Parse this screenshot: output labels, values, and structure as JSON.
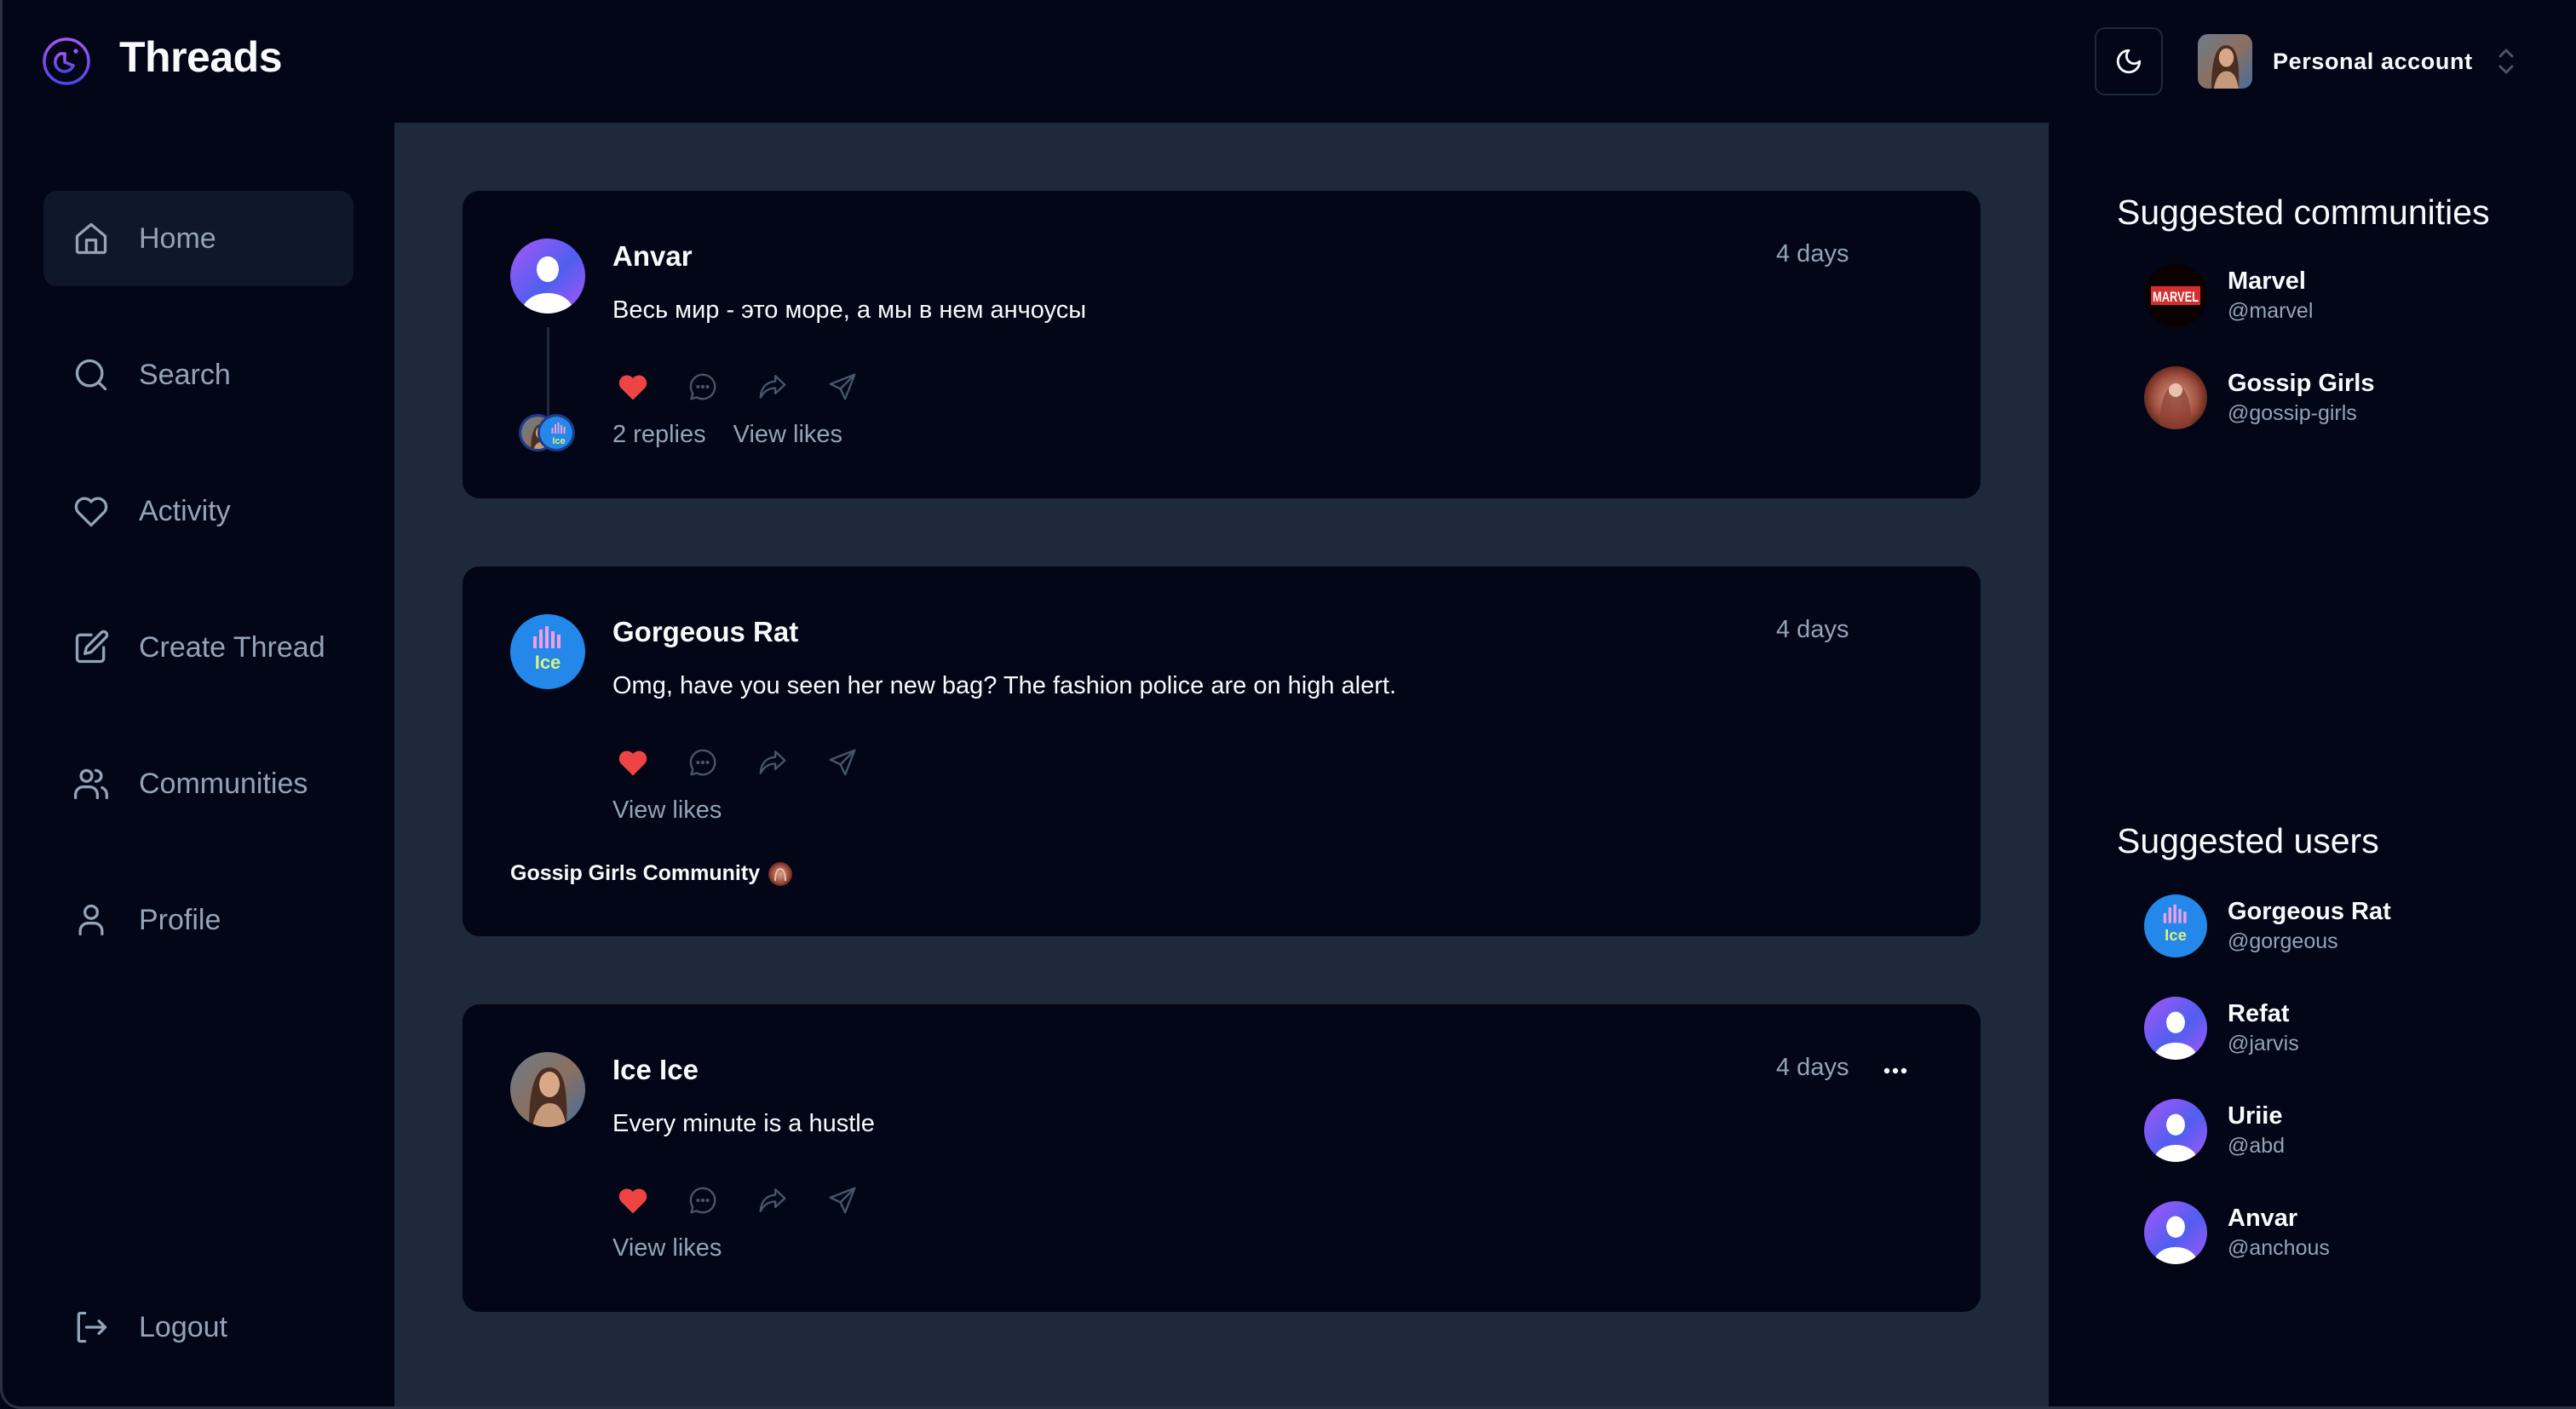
{
  "app": {
    "title": "Threads",
    "logo_icon": "threads-logo-icon",
    "accent_color": "#7c3aed"
  },
  "header": {
    "theme_toggle_icon": "moon-icon",
    "account_label": "Personal account",
    "account_chevron_icon": "chevron-up-down-icon"
  },
  "sidebar": {
    "items": [
      {
        "label": "Home",
        "icon": "home-icon",
        "active": true
      },
      {
        "label": "Search",
        "icon": "search-icon",
        "active": false
      },
      {
        "label": "Activity",
        "icon": "heart-icon",
        "active": false
      },
      {
        "label": "Create Thread",
        "icon": "edit-icon",
        "active": false
      },
      {
        "label": "Communities",
        "icon": "users-icon",
        "active": false
      },
      {
        "label": "Profile",
        "icon": "user-icon",
        "active": false
      }
    ],
    "logout_label": "Logout",
    "logout_icon": "logout-icon"
  },
  "feed": {
    "threads": [
      {
        "author": "Anvar",
        "avatar": "default-avatar",
        "time": "4 days",
        "content": "Весь мир - это море, а мы в нем анчоусы",
        "liked": true,
        "replies_label": "2 replies",
        "view_likes_label": "View likes",
        "show_more": false
      },
      {
        "author": "Gorgeous Rat",
        "avatar": "ice-avatar",
        "time": "4 days",
        "content": "Omg, have you seen her new bag? The fashion police are on high alert.",
        "liked": true,
        "view_likes_label": "View likes",
        "community_label": "Gossip Girls Community",
        "show_more": false
      },
      {
        "author": "Ice Ice",
        "avatar": "photo-avatar",
        "time": "4 days",
        "content": "Every minute is a hustle",
        "liked": true,
        "view_likes_label": "View likes",
        "show_more": true
      }
    ],
    "like_color": "#ef4444"
  },
  "rightbar": {
    "communities_heading": "Suggested communities",
    "communities": [
      {
        "name": "Marvel",
        "handle": "@marvel",
        "avatar": "marvel-logo"
      },
      {
        "name": "Gossip Girls",
        "handle": "@gossip-girls",
        "avatar": "gossip-girls-image"
      }
    ],
    "users_heading": "Suggested users",
    "users": [
      {
        "name": "Gorgeous Rat",
        "handle": "@gorgeous",
        "avatar": "ice-avatar"
      },
      {
        "name": "Refat",
        "handle": "@jarvis",
        "avatar": "default-avatar"
      },
      {
        "name": "Uriie",
        "handle": "@abd",
        "avatar": "default-avatar"
      },
      {
        "name": "Anvar",
        "handle": "@anchous",
        "avatar": "default-avatar"
      }
    ]
  }
}
